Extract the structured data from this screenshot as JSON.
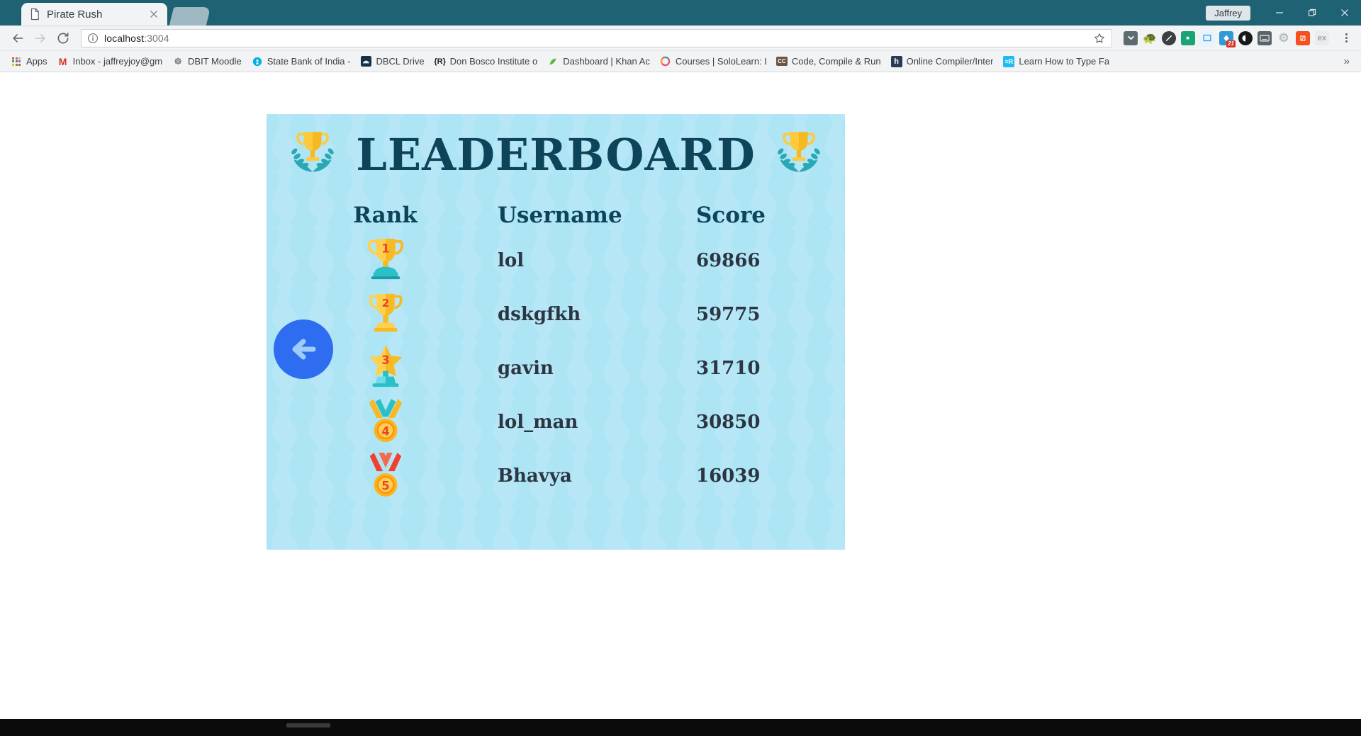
{
  "window": {
    "user_label": "Jaffrey",
    "minimize_icon": "minimize-icon",
    "maximize_icon": "restore-icon",
    "close_icon": "close-icon"
  },
  "tab": {
    "title": "Pirate Rush",
    "favicon": "page-icon",
    "close_icon": "close-icon"
  },
  "toolbar": {
    "back_icon": "back-arrow-icon",
    "forward_icon": "forward-arrow-icon",
    "reload_icon": "reload-icon",
    "info_icon": "info-circle-icon",
    "star_icon": "star-outline-icon",
    "menu_icon": "three-dot-menu-icon",
    "url_host": "localhost",
    "url_port": ":3004",
    "extensions": [
      {
        "name": "pocket-extension-icon",
        "color": "#5c6b70",
        "glyph": "⌄",
        "badge": ""
      },
      {
        "name": "evernote-extension-icon",
        "color": "#6d7a7e",
        "glyph": "●",
        "badge": ""
      },
      {
        "name": "adblock-extension-icon",
        "color": "#3a3f41",
        "glyph": "●",
        "badge": ""
      },
      {
        "name": "grammarly-extension-icon",
        "color": "#17a673",
        "glyph": "▪",
        "badge": ""
      },
      {
        "name": "screenshot-extension-icon",
        "color": "#3aa0e8",
        "glyph": "□",
        "badge": ""
      },
      {
        "name": "notifications-extension-icon",
        "color": "#2f9bd6",
        "glyph": "◆",
        "badge": "21"
      },
      {
        "name": "dark-reader-extension-icon",
        "color": "#17181a",
        "glyph": "◑",
        "badge": ""
      },
      {
        "name": "keyboard-extension-icon",
        "color": "#5a6368",
        "glyph": "⌸",
        "badge": ""
      },
      {
        "name": "settings-gear-extension-icon",
        "color": "#b9bec1",
        "glyph": "⚙",
        "badge": ""
      },
      {
        "name": "translate-extension-icon",
        "color": "#f4511e",
        "glyph": "文",
        "badge": ""
      },
      {
        "name": "profile-avatar-icon",
        "color": "#e9edef",
        "glyph": "ex",
        "badge": ""
      }
    ]
  },
  "bookmarks": {
    "apps_label": "Apps",
    "overflow_label": "»",
    "items": [
      {
        "label": "Inbox - jaffreyjoy@gm",
        "icon": "gmail-icon",
        "color": "#d93025",
        "glyph": "M"
      },
      {
        "label": "DBIT Moodle",
        "icon": "moodle-icon",
        "color": "#5f6368",
        "glyph": "⚇"
      },
      {
        "label": "State Bank of India -",
        "icon": "sbi-icon",
        "color": "#00b0e6",
        "glyph": "●"
      },
      {
        "label": "DBCL Drive",
        "icon": "dbcl-drive-icon",
        "color": "#16324a",
        "glyph": "☁"
      },
      {
        "label": "Don Bosco Institute o",
        "icon": "dbit-icon",
        "color": "#202124",
        "glyph": "R"
      },
      {
        "label": "Dashboard | Khan Ac",
        "icon": "khan-academy-icon",
        "color": "#5cb646",
        "glyph": "❧"
      },
      {
        "label": "Courses | SoloLearn: L",
        "icon": "sololearn-icon",
        "color": "#ef4c78",
        "glyph": "◌"
      },
      {
        "label": "Code, Compile & Run",
        "icon": "cc-icon",
        "color": "#6b5544",
        "glyph": "CC"
      },
      {
        "label": "Online Compiler/Inter",
        "icon": "hackerearth-icon",
        "color": "#2b3a55",
        "glyph": "h"
      },
      {
        "label": "Learn How to Type Fa",
        "icon": "typing-icon",
        "color": "#20b9f2",
        "glyph": "R"
      }
    ]
  },
  "page": {
    "title": "LEADERBOARD",
    "left_trophy_icon": "trophy-laurel-icon",
    "right_trophy_icon": "trophy-laurel-icon",
    "back_button_icon": "back-arrow-circle-icon",
    "columns": {
      "rank": "Rank",
      "username": "Username",
      "score": "Score"
    },
    "colors": {
      "panel_bg": "#aee5f5",
      "wave": "#bfeaf8",
      "title": "#0d4459",
      "value": "#2b3642",
      "back_button": "#2f6df0",
      "gold": "#ffc93c",
      "teal": "#2aa8b5"
    },
    "rows": [
      {
        "rank": "1",
        "rank_icon": "gold-trophy-icon",
        "username": "lol",
        "score": "69866"
      },
      {
        "rank": "2",
        "rank_icon": "gold-trophy-icon",
        "username": "dskgfkh",
        "score": "59775"
      },
      {
        "rank": "3",
        "rank_icon": "star-trophy-icon",
        "username": "gavin",
        "score": "31710"
      },
      {
        "rank": "4",
        "rank_icon": "orange-medal-icon",
        "username": "lol_man",
        "score": "30850"
      },
      {
        "rank": "5",
        "rank_icon": "red-medal-icon",
        "username": "Bhavya",
        "score": "16039"
      }
    ]
  }
}
